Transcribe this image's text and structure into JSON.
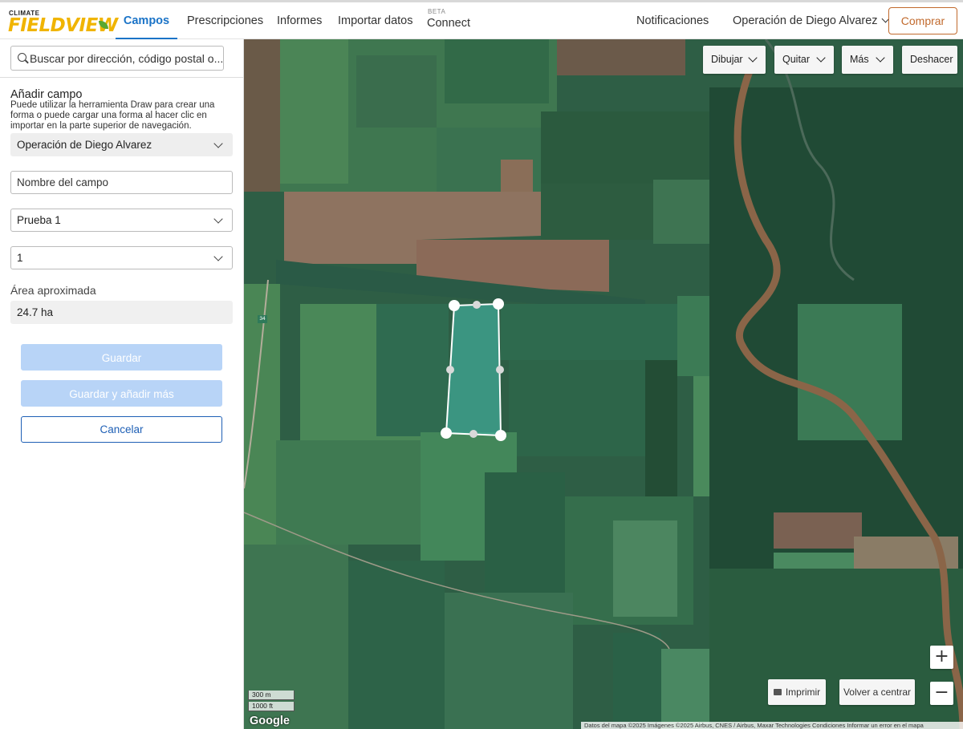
{
  "nav": {
    "logo_top": "CLIMATE",
    "logo_main": "FIELDVIEW",
    "items": [
      {
        "label": "Campos"
      },
      {
        "label": "Prescripciones"
      },
      {
        "label": "Informes"
      },
      {
        "label": "Importar datos"
      }
    ],
    "beta_tag": "BETA",
    "connect": "Connect",
    "notifications": "Notificaciones",
    "operation": "Operación de Diego Alvarez",
    "buy": "Comprar"
  },
  "sidebar": {
    "search_placeholder": "Buscar por dirección, código postal o...",
    "add_field_title": "Añadir campo",
    "add_field_desc": "Puede utilizar la herramienta Draw para crear una forma o puede cargar una forma al hacer clic en importar en la parte superior de navegación.",
    "operation_select": "Operación de Diego Alvarez",
    "field_name_placeholder": "Nombre del campo",
    "farm_select": "Prueba 1",
    "number_select": "1",
    "area_label": "Área aproximada",
    "area_value": "24.7 ha",
    "save": "Guardar",
    "save_add": "Guardar y añadir más",
    "cancel": "Cancelar"
  },
  "map": {
    "draw": "Dibujar",
    "remove": "Quitar",
    "more": "Más",
    "undo": "Deshacer",
    "zoom_in": "+",
    "zoom_out": "−",
    "print": "Imprimir",
    "recenter": "Volver a centrar",
    "scale_m": "300 m",
    "scale_ft": "1000 ft",
    "google": "Google",
    "road_marker": "34",
    "attribution": "Datos del mapa ©2025 Imágenes ©2025 Airbus, CNES / Airbus, Maxar Technologies   Condiciones   Informar un error en el mapa"
  },
  "colors": {
    "accent": "#1a73c7",
    "buy": "#c1692c",
    "disabled_btn": "#b8d4f7",
    "cancel_border": "#1e5fb5",
    "logo_yellow": "#f0b400"
  }
}
